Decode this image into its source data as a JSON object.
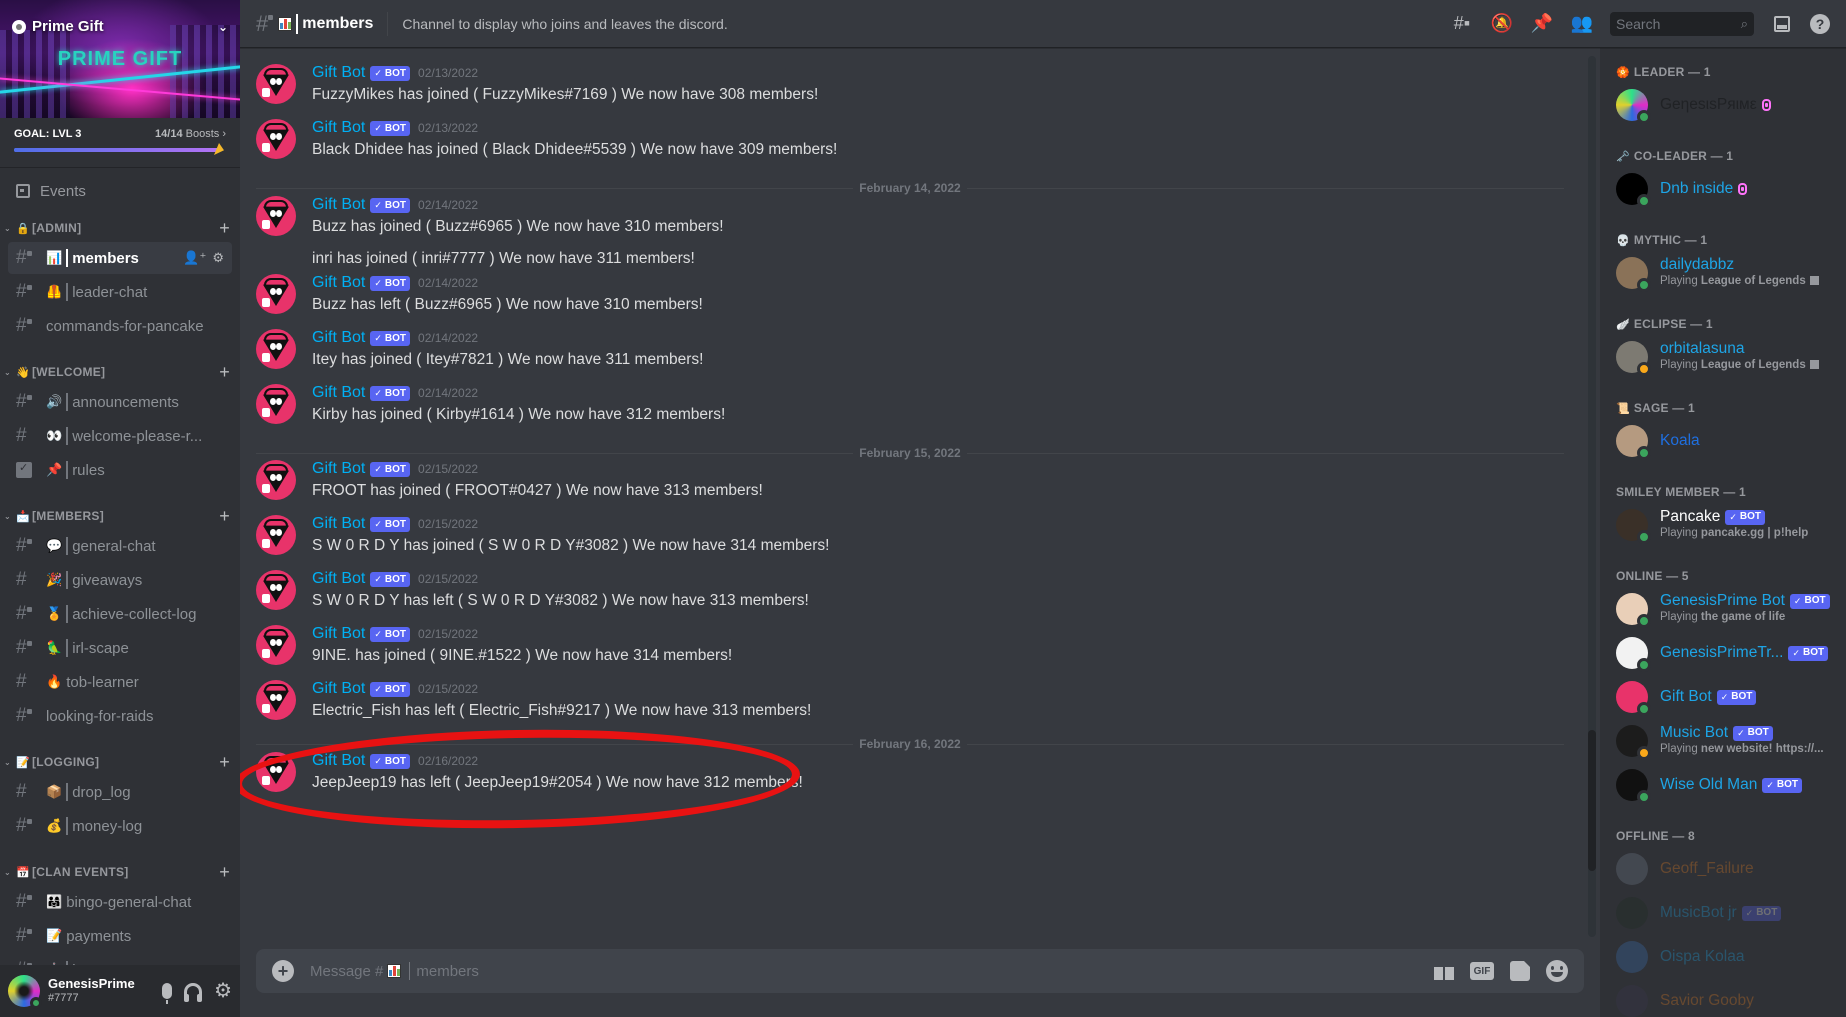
{
  "server": {
    "name": "Prime Gift",
    "banner_text": "PRIME GIFT",
    "goal_label": "GOAL: LVL 3",
    "boosts_count": "14/14",
    "boosts_label": "Boosts",
    "boost_progress_percent": 100
  },
  "sidebar": {
    "events_label": "Events",
    "categories": [
      {
        "label": "[ADMIN]",
        "emoji": "🔒",
        "channels": [
          {
            "label": "members",
            "emoji": "📊",
            "active": true,
            "locked": true,
            "type": "text"
          },
          {
            "label": "leader-chat",
            "emoji": "🦺",
            "locked": true,
            "type": "text"
          },
          {
            "label": "commands-for-pancake",
            "emoji": "",
            "locked": true,
            "type": "text"
          }
        ]
      },
      {
        "label": "[WELCOME]",
        "emoji": "👋",
        "channels": [
          {
            "label": "announcements",
            "emoji": "🔊",
            "locked": true,
            "type": "text"
          },
          {
            "label": "welcome-please-r...",
            "emoji": "👀",
            "locked": false,
            "type": "text"
          },
          {
            "label": "rules",
            "emoji": "📌",
            "locked": false,
            "type": "rules"
          }
        ]
      },
      {
        "label": "[MEMBERS]",
        "emoji": "📩",
        "channels": [
          {
            "label": "general-chat",
            "emoji": "💬",
            "locked": true,
            "type": "text"
          },
          {
            "label": "giveaways",
            "emoji": "🎉",
            "locked": false,
            "type": "text"
          },
          {
            "label": "achieve-collect-log",
            "emoji": "🏅",
            "locked": true,
            "type": "text"
          },
          {
            "label": "irl-scape",
            "emoji": "🦜",
            "locked": true,
            "type": "text"
          },
          {
            "label": "tob-learner",
            "emoji": "🔥",
            "locked": false,
            "type": "text",
            "no_sep": true
          },
          {
            "label": "looking-for-raids",
            "emoji": "",
            "locked": true,
            "type": "text"
          }
        ]
      },
      {
        "label": "[LOGGING]",
        "emoji": "📝",
        "channels": [
          {
            "label": "drop_log",
            "emoji": "📦",
            "locked": false,
            "type": "text"
          },
          {
            "label": "money-log",
            "emoji": "💰",
            "locked": true,
            "type": "text"
          }
        ]
      },
      {
        "label": "[CLAN EVENTS]",
        "emoji": "📅",
        "channels": [
          {
            "label": "bingo-general-chat",
            "emoji": "👨‍👩‍👧",
            "locked": true,
            "type": "text",
            "no_sep": true
          },
          {
            "label": "payments",
            "emoji": "📝",
            "locked": true,
            "type": "text",
            "no_sep": true
          },
          {
            "label": "bot-spam",
            "emoji": "🤖",
            "locked": true,
            "type": "text"
          }
        ]
      }
    ]
  },
  "user": {
    "name": "GenesisPrime",
    "tag": "#7777",
    "status": "online"
  },
  "header": {
    "channel_emoji": "📊",
    "channel_name": "members",
    "topic": "Channel to display who joins and leaves the discord.",
    "search_placeholder": "Search"
  },
  "chat": {
    "bot_tag": "BOT",
    "messages": [
      {
        "author": "Gift Bot",
        "timestamp": "02/13/2022",
        "lines": [
          "FuzzyMikes has joined ( FuzzyMikes#7169 ) We now have 308 members!"
        ]
      },
      {
        "author": "Gift Bot",
        "timestamp": "02/13/2022",
        "lines": [
          "Black Dhidee has joined ( Black Dhidee#5539 ) We now have 309 members!"
        ]
      },
      {
        "divider": "February 14, 2022"
      },
      {
        "author": "Gift Bot",
        "timestamp": "02/14/2022",
        "lines": [
          "Buzz has joined ( Buzz#6965 ) We now have 310 members!",
          "inri has joined ( inri#7777 ) We now have 311 members!"
        ]
      },
      {
        "author": "Gift Bot",
        "timestamp": "02/14/2022",
        "lines": [
          "Buzz has left ( Buzz#6965 ) We now have 310 members!"
        ]
      },
      {
        "author": "Gift Bot",
        "timestamp": "02/14/2022",
        "lines": [
          "Itey has joined ( Itey#7821 ) We now have 311 members!"
        ]
      },
      {
        "author": "Gift Bot",
        "timestamp": "02/14/2022",
        "lines": [
          "Kirby has joined ( Kirby#1614 ) We now have 312 members!"
        ]
      },
      {
        "divider": "February 15, 2022"
      },
      {
        "author": "Gift Bot",
        "timestamp": "02/15/2022",
        "lines": [
          "FROOT has joined ( FROOT#0427 ) We now have 313 members!"
        ]
      },
      {
        "author": "Gift Bot",
        "timestamp": "02/15/2022",
        "lines": [
          "S W 0 R D Y has joined ( S W 0 R D Y#3082 ) We now have 314 members!"
        ]
      },
      {
        "author": "Gift Bot",
        "timestamp": "02/15/2022",
        "lines": [
          "S W 0 R D Y has left ( S W 0 R D Y#3082 ) We now have 313 members!"
        ]
      },
      {
        "author": "Gift Bot",
        "timestamp": "02/15/2022",
        "lines": [
          "9INE. has joined ( 9INE.#1522 ) We now have 314 members!"
        ]
      },
      {
        "author": "Gift Bot",
        "timestamp": "02/15/2022",
        "lines": [
          "Electric_Fish has left ( Electric_Fish#9217 ) We now have 313 members!"
        ]
      },
      {
        "divider": "February 16, 2022"
      },
      {
        "author": "Gift Bot",
        "timestamp": "02/16/2022",
        "lines": [
          "JeepJeep19 has left ( JeepJeep19#2054 ) We now have 312 members!"
        ],
        "highlighted": true
      }
    ],
    "composer_prefix": "Message #",
    "composer_channel": "members",
    "composer_icons": [
      "gift-icon",
      "gif-icon",
      "sticker-icon",
      "emoji-icon"
    ],
    "gif_label": "GIF"
  },
  "member_list": {
    "groups": [
      {
        "label": "LEADER — 1",
        "emoji": "🏵️",
        "members": [
          {
            "name": "GeηesιsPяιмε",
            "color": "#202225",
            "status": "online",
            "gem": true,
            "avatar": "conic"
          }
        ]
      },
      {
        "label": "CO-LEADER — 1",
        "emoji": "🗝️",
        "members": [
          {
            "name": "Dnb inside",
            "color": "#1ea5e6",
            "status": "online",
            "gem": true,
            "avatar": "#000000"
          }
        ]
      },
      {
        "label": "MYTHIC — 1",
        "emoji": "💀",
        "members": [
          {
            "name": "dailydabbz",
            "color": "#1ea5e6",
            "status": "online",
            "activity_prefix": "Playing",
            "activity": "League of Legends",
            "rich": true,
            "avatar": "#8a7258"
          }
        ]
      },
      {
        "label": "ECLIPSE — 1",
        "emoji": "🪽",
        "members": [
          {
            "name": "orbitalasuna",
            "color": "#1ea5e6",
            "status": "idle",
            "activity_prefix": "Playing",
            "activity": "League of Legends",
            "rich": true,
            "avatar": "#7d7a72"
          }
        ]
      },
      {
        "label": "SAGE — 1",
        "emoji": "📜",
        "members": [
          {
            "name": "Koala",
            "color": "#1f6fe0",
            "status": "online",
            "avatar": "#b59a80"
          }
        ]
      },
      {
        "label": "SMILEY MEMBER — 1",
        "emoji": "",
        "members": [
          {
            "name": "Pancake",
            "color": "#ffffff",
            "status": "online",
            "bot": true,
            "activity_prefix": "Playing",
            "activity": "pancake.gg | p!help",
            "avatar": "#3a3028"
          }
        ]
      },
      {
        "label": "ONLINE — 5",
        "emoji": "",
        "members": [
          {
            "name": "GenesisPrime Bot",
            "color": "#1ea5e6",
            "status": "online",
            "bot": true,
            "activity_prefix": "Playing",
            "activity": "the game of life",
            "avatar": "#e9cfb8"
          },
          {
            "name": "GenesisPrimeTr...",
            "color": "#1ea5e6",
            "status": "online",
            "bot": true,
            "avatar": "#f2f2f2"
          },
          {
            "name": "Gift Bot",
            "color": "#1ea5e6",
            "status": "online",
            "bot": true,
            "avatar": "#e8336a"
          },
          {
            "name": "Music Bot",
            "color": "#1ea5e6",
            "status": "idle",
            "bot": true,
            "activity_prefix": "Playing",
            "activity": "new website! https://...",
            "avatar": "#1c1c1c"
          },
          {
            "name": "Wise Old Man",
            "color": "#1ea5e6",
            "status": "online",
            "bot": true,
            "avatar": "#111111"
          }
        ]
      },
      {
        "label": "OFFLINE — 8",
        "emoji": "",
        "members": [
          {
            "name": "Geoff_Failure",
            "color": "#e67e22",
            "status": "offline",
            "avatar": "#747f8d"
          },
          {
            "name": "MusicBot jr",
            "color": "#1ea5e6",
            "status": "offline",
            "bot": true,
            "avatar": "#1f2a22"
          },
          {
            "name": "Oispa Kolaa",
            "color": "#1ea5e6",
            "status": "offline",
            "avatar": "#3a6fb5"
          },
          {
            "name": "Savior Gooby",
            "color": "#e67e22",
            "status": "offline",
            "avatar": "#3a3550"
          }
        ]
      }
    ]
  }
}
